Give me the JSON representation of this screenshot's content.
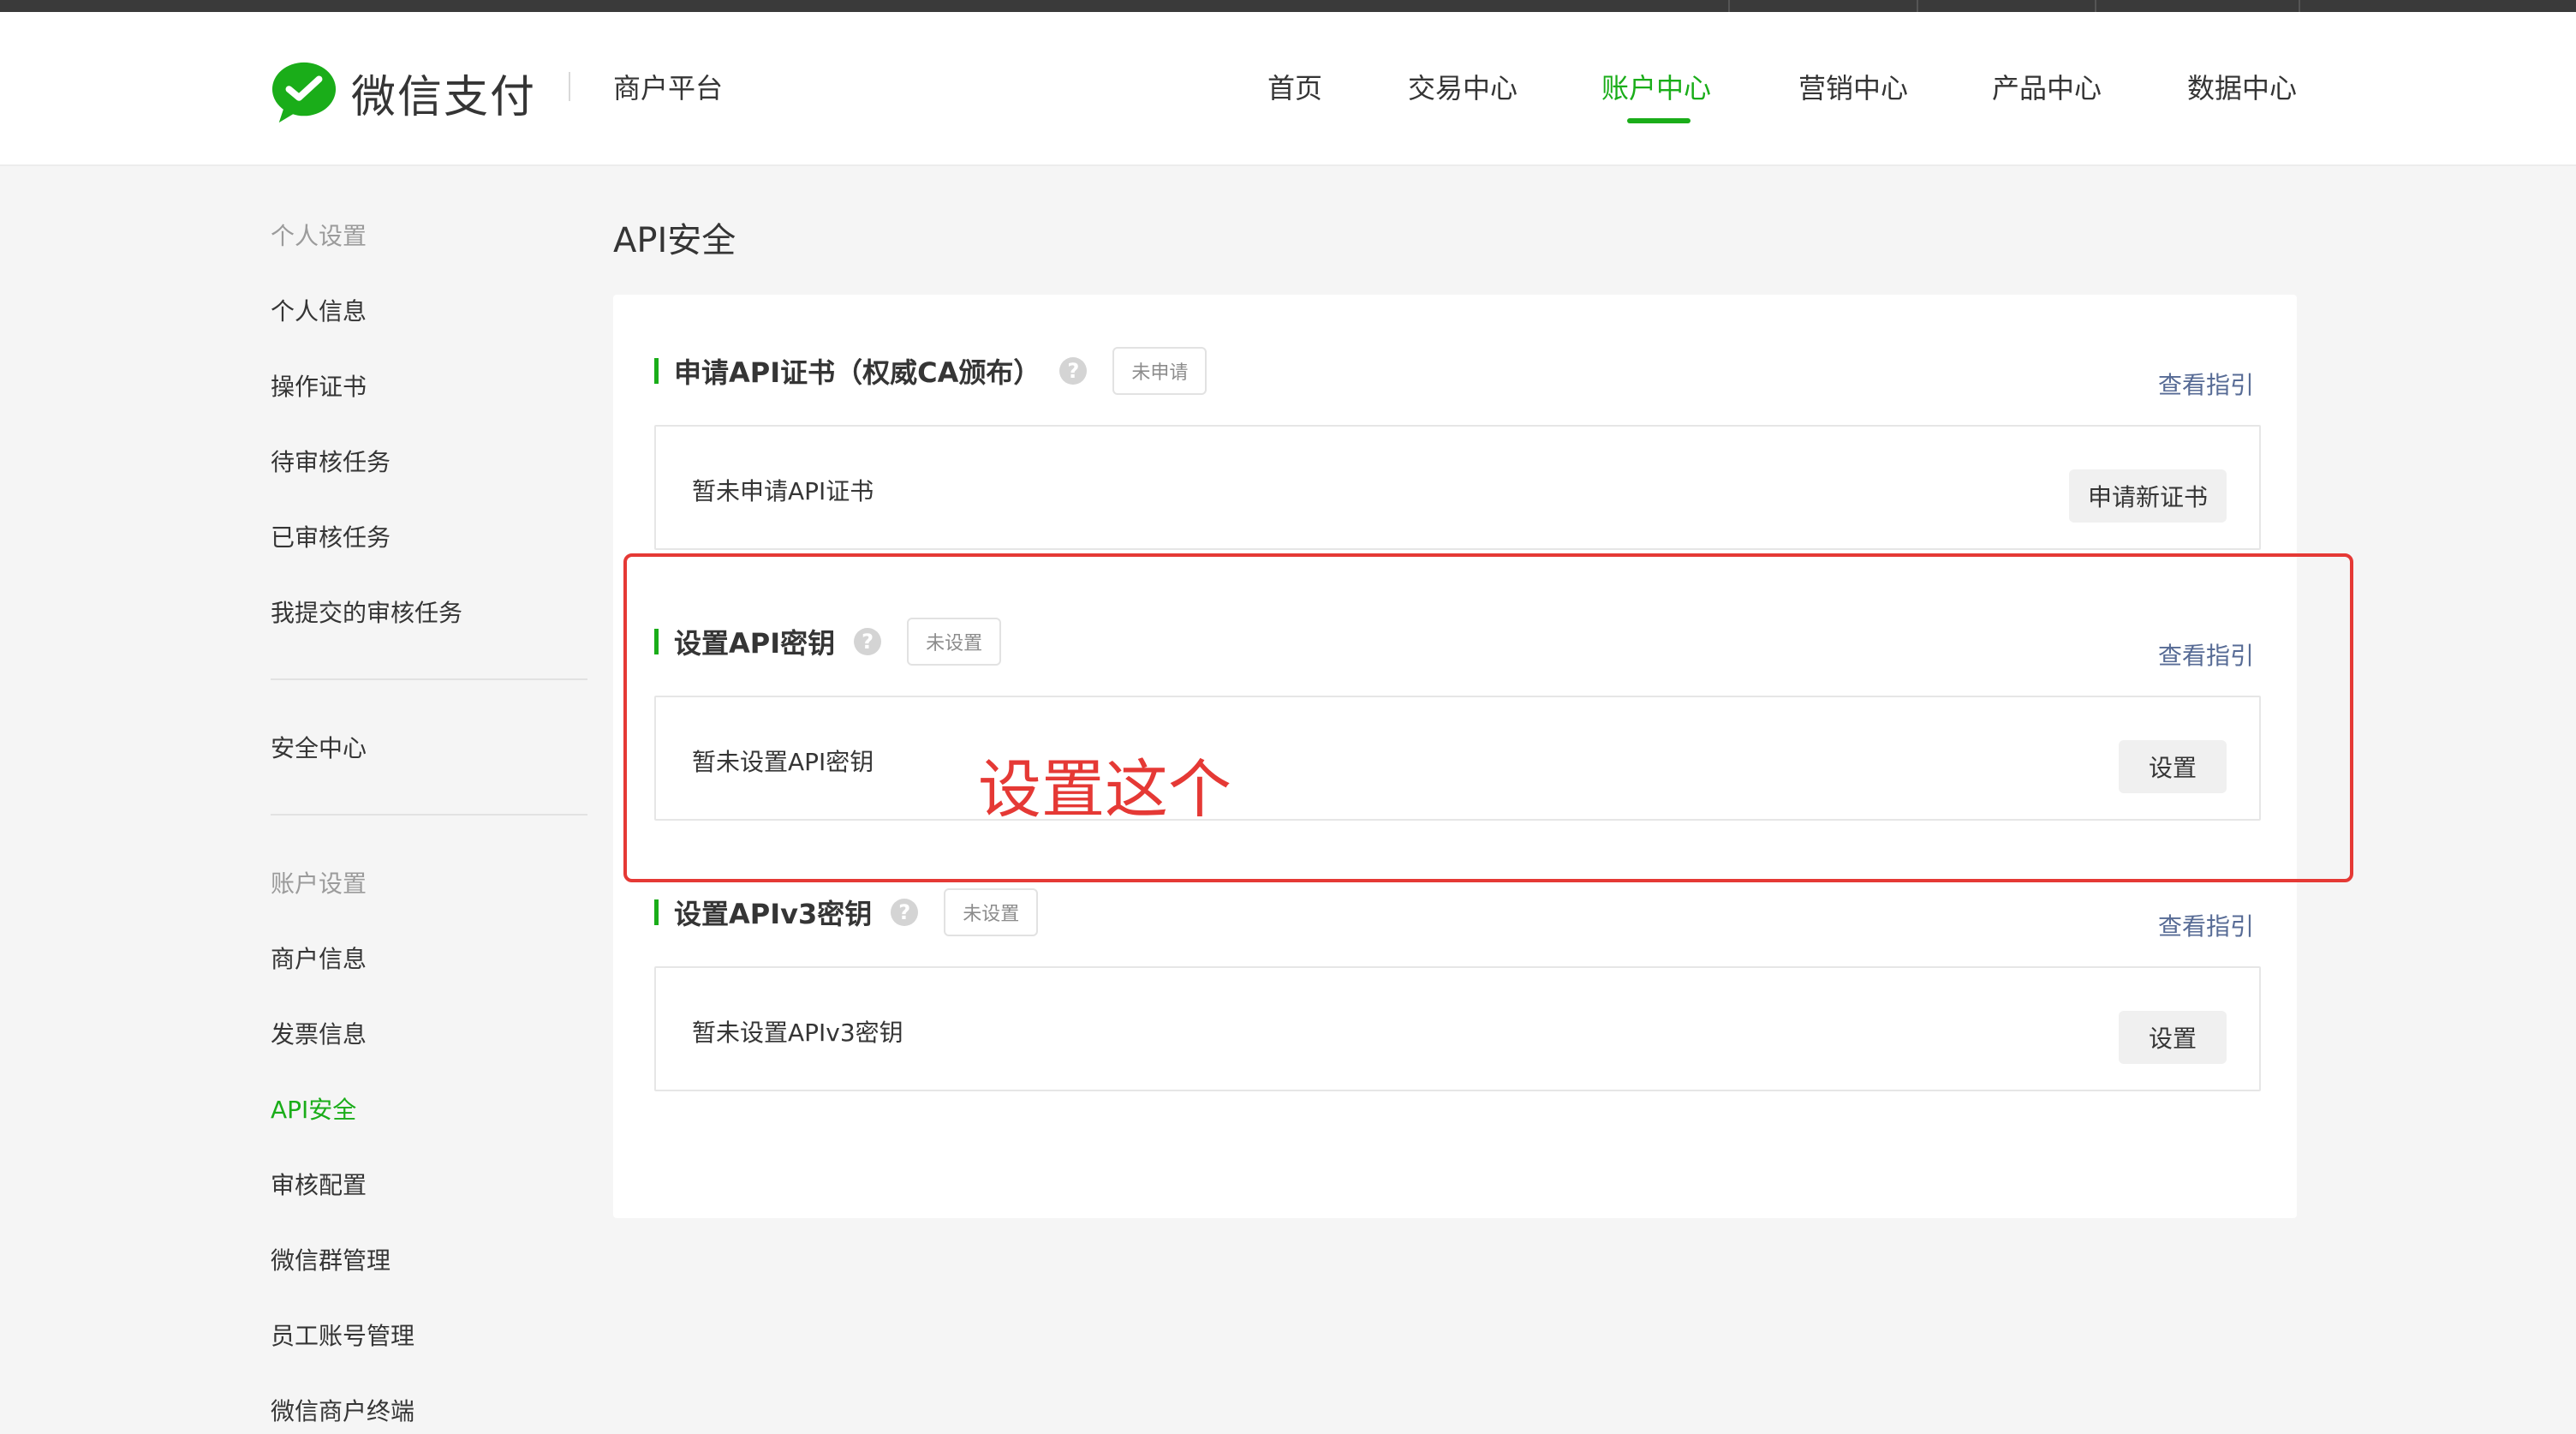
{
  "brand": {
    "logo_text": "微信支付",
    "platform": "商户平台",
    "accent": "#1aad19"
  },
  "nav": {
    "items": [
      "首页",
      "交易中心",
      "账户中心",
      "营销中心",
      "产品中心",
      "数据中心"
    ],
    "active": "账户中心"
  },
  "sidebar": {
    "groups": [
      {
        "title": "个人设置",
        "items": [
          "个人信息",
          "操作证书",
          "待审核任务",
          "已审核任务",
          "我提交的审核任务"
        ]
      },
      {
        "title": "",
        "items": [
          "安全中心"
        ]
      },
      {
        "title": "账户设置",
        "items": [
          "商户信息",
          "发票信息",
          "API安全",
          "审核配置",
          "微信群管理",
          "员工账号管理",
          "微信商户终端"
        ]
      }
    ],
    "active_item": "API安全"
  },
  "main": {
    "page_title": "API安全",
    "sections": [
      {
        "title": "申请API证书（权威CA颁布）",
        "status": "未申请",
        "guide": "查看指引",
        "message": "暂未申请API证书",
        "button": "申请新证书"
      },
      {
        "title": "设置API密钥",
        "status": "未设置",
        "guide": "查看指引",
        "message": "暂未设置API密钥",
        "button": "设置"
      },
      {
        "title": "设置APIv3密钥",
        "status": "未设置",
        "guide": "查看指引",
        "message": "暂未设置APIv3密钥",
        "button": "设置"
      }
    ]
  },
  "annotation": {
    "text": "设置这个",
    "color": "#e53935"
  },
  "icons": {
    "help": "question-circle-icon",
    "help_glyph": "?"
  }
}
